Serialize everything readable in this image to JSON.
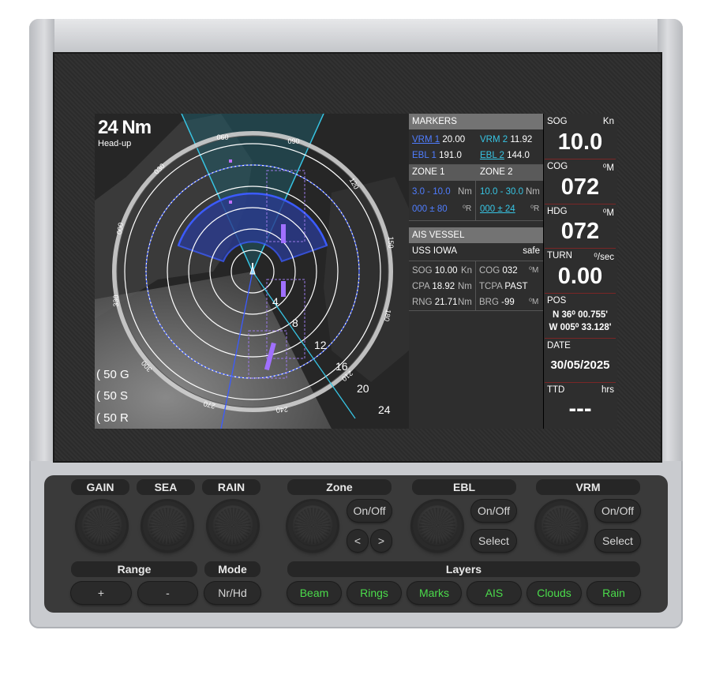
{
  "radar": {
    "range": "24 Nm",
    "mode": "Head-up",
    "bearing_labels": [
      "060",
      "090",
      "120",
      "150",
      "180",
      "210",
      "240",
      "270",
      "300",
      "330",
      "000",
      "030"
    ],
    "ring_labels": [
      "4",
      "8",
      "12",
      "16",
      "20",
      "24"
    ],
    "gain": "50 G",
    "sea": "50 S",
    "rain": "50 R",
    "colors": {
      "zone1": "#3b5bff",
      "zone2": "#37c5e4",
      "ais": "#a070ff"
    }
  },
  "markers": {
    "title": "MARKERS",
    "vrm1_label": "VRM 1",
    "vrm1_value": "20.00",
    "vrm2_label": "VRM 2",
    "vrm2_value": "11.92",
    "ebl1_label": "EBL 1",
    "ebl1_value": "191.0",
    "ebl2_label": "EBL 2",
    "ebl2_value": "144.0"
  },
  "zones": {
    "zone1_title": "ZONE 1",
    "zone2_title": "ZONE 2",
    "zone1_range": "3.0 - 10.0",
    "zone2_range": "10.0 - 30.0",
    "range_unit": "Nm",
    "zone1_bearing": "000 ± 80",
    "zone2_bearing": "000 ± 24",
    "bearing_unit": "⁰R"
  },
  "ais": {
    "title": "AIS VESSEL",
    "name": "USS IOWA",
    "status": "safe",
    "sog_label": "SOG",
    "sog_value": "10.00",
    "sog_unit": "Kn",
    "cog_label": "COG",
    "cog_value": "032",
    "cog_unit": "⁰M",
    "cpa_label": "CPA",
    "cpa_value": "18.92",
    "cpa_unit": "Nm",
    "tcpa_label": "TCPA",
    "tcpa_value": "PAST",
    "rng_label": "RNG",
    "rng_value": "21.71",
    "rng_unit": "Nm",
    "brg_label": "BRG",
    "brg_value": "-99",
    "brg_unit": "⁰M"
  },
  "nav": {
    "sog_label": "SOG",
    "sog_unit": "Kn",
    "sog_value": "10.0",
    "cog_label": "COG",
    "cog_unit": "⁰M",
    "cog_value": "072",
    "hdg_label": "HDG",
    "hdg_unit": "⁰M",
    "hdg_value": "072",
    "turn_label": "TURN",
    "turn_unit": "⁰/sec",
    "turn_value": "0.00",
    "pos_label": "POS",
    "pos_lat": "N 36⁰ 00.755'",
    "pos_lon": "W 005⁰ 33.128'",
    "date_label": "DATE",
    "date_value": "30/05/2025",
    "ttd_label": "TTD",
    "ttd_unit": "hrs",
    "ttd_value": "---"
  },
  "controls": {
    "gain": "GAIN",
    "sea": "SEA",
    "rain": "RAIN",
    "zone": "Zone",
    "ebl": "EBL",
    "vrm": "VRM",
    "on_off": "On/Off",
    "select": "Select",
    "prev": "<",
    "next": ">",
    "range": "Range",
    "mode": "Mode",
    "range_plus": "+",
    "range_minus": "-",
    "mode_btn": "Nr/Hd",
    "layers": "Layers",
    "layer_buttons": [
      "Beam",
      "Rings",
      "Marks",
      "AIS",
      "Clouds",
      "Rain"
    ]
  }
}
